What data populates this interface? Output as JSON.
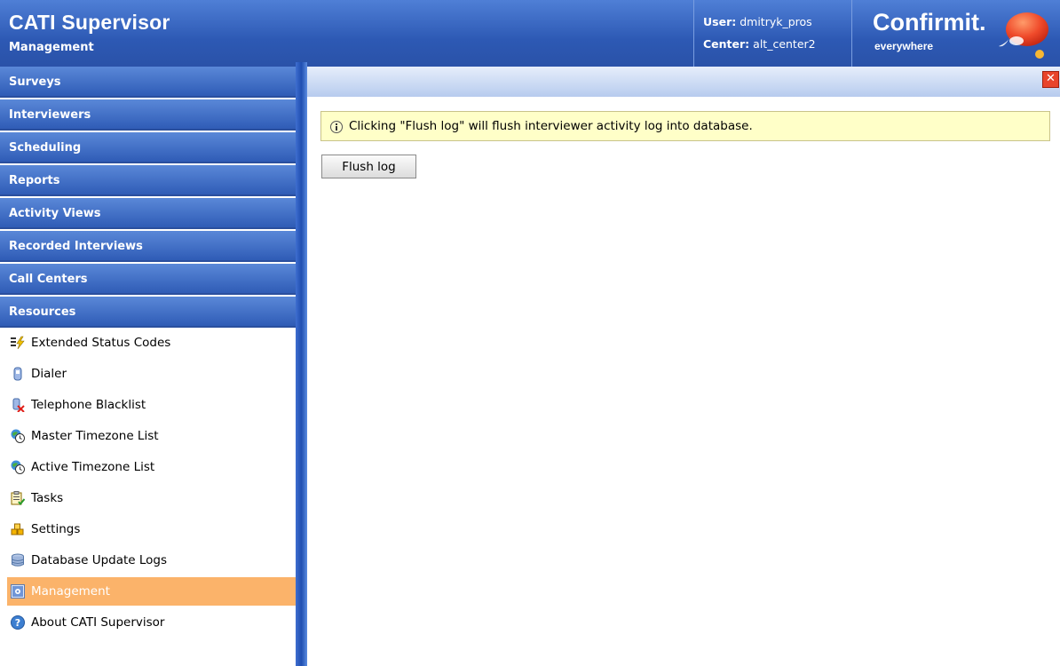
{
  "header": {
    "title": "CATI Supervisor",
    "subtitle": "Management",
    "user_label": "User:",
    "user_value": "dmitryk_pros",
    "center_label": "Center:",
    "center_value": "alt_center2",
    "logo_text": "Confirmit.",
    "logo_sub": "everywhere",
    "color": "#2d59b4"
  },
  "sidebar": {
    "sections": [
      {
        "label": "Surveys"
      },
      {
        "label": "Interviewers"
      },
      {
        "label": "Scheduling"
      },
      {
        "label": "Reports"
      },
      {
        "label": "Activity Views"
      },
      {
        "label": "Recorded Interviews"
      },
      {
        "label": "Call Centers"
      },
      {
        "label": "Resources"
      }
    ],
    "items": [
      {
        "label": "Extended Status Codes",
        "icon": "status-codes-icon"
      },
      {
        "label": "Dialer",
        "icon": "dialer-icon"
      },
      {
        "label": "Telephone Blacklist",
        "icon": "telephone-blacklist-icon"
      },
      {
        "label": "Master Timezone List",
        "icon": "timezone-icon"
      },
      {
        "label": "Active Timezone List",
        "icon": "timezone-icon"
      },
      {
        "label": "Tasks",
        "icon": "tasks-icon"
      },
      {
        "label": "Settings",
        "icon": "settings-icon"
      },
      {
        "label": "Database Update Logs",
        "icon": "database-icon"
      },
      {
        "label": "Management",
        "icon": "management-icon",
        "active": true
      },
      {
        "label": "About CATI Supervisor",
        "icon": "help-icon"
      }
    ],
    "active_color": "#fbb36a"
  },
  "main": {
    "close_glyph": "✕",
    "notice": "Clicking \"Flush log\" will flush interviewer activity log into database.",
    "flush_button": "Flush log"
  }
}
